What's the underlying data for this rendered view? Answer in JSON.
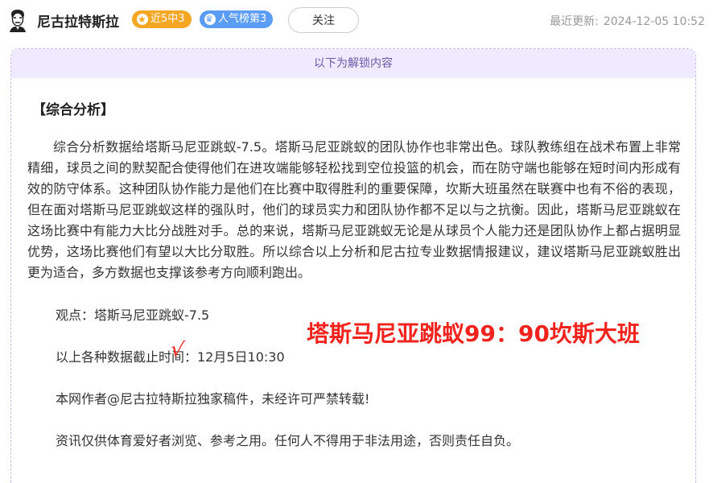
{
  "header": {
    "author_name": "尼古拉特斯拉",
    "badge_streak": "近5中3",
    "badge_rank": "人气榜第3",
    "follow_label": "关注",
    "update_label": "最近更新:",
    "update_time": "2024-12-05 10:52",
    "icons": {
      "avatar": "tesla-portrait-icon",
      "streak": "star-icon",
      "rank": "crown-icon"
    },
    "colors": {
      "streak_badge": "#f5a623",
      "rank_badge": "#5b9cf5"
    }
  },
  "unlock": {
    "banner_text": "以下为解锁内容",
    "banner_color": "#efeaff"
  },
  "article": {
    "section_title": "【综合分析】",
    "paragraph": "综合分析数据给塔斯马尼亚跳蚁-7.5。塔斯马尼亚跳蚁的团队协作也非常出色。球队教练组在战术布置上非常精细，球员之间的默契配合使得他们在进攻端能够轻松找到空位投篮的机会，而在防守端也能够在短时间内形成有效的防守体系。这种团队协作能力是他们在比赛中取得胜利的重要保障，坎斯大班虽然在联赛中也有不俗的表现，但在面对塔斯马尼亚跳蚁这样的强队时，他们的球员实力和团队协作都不足以与之抗衡。因此，塔斯马尼亚跳蚁在这场比赛中有能力大比分战胜对手。总的来说，塔斯马尼亚跳蚁无论是从球员个人能力还是团队协作上都占据明显优势，这场比赛他们有望以大比分取胜。所以综合以上分析和尼古拉专业数据情报建议，建议塔斯马尼亚跳蚁胜出更为适合，多方数据也支撑该参考方向顺利跑出。",
    "view_line": "观点：塔斯马尼亚跳蚁-7.5",
    "deadline_line": "以上各种数据截止时间：12月5日10:30",
    "copyright_line": "本网作者@尼古拉特斯拉独家稿件，未经许可严禁转载!",
    "disclaimer_line": "资讯仅供体育爱好者浏览、参考之用。任何人不得用于非法用途，否则责任自负。"
  },
  "overlay": {
    "score_text": "塔斯马尼亚跳蚁99：90坎斯大班",
    "check_mark": "√",
    "color": "#f2231d"
  }
}
